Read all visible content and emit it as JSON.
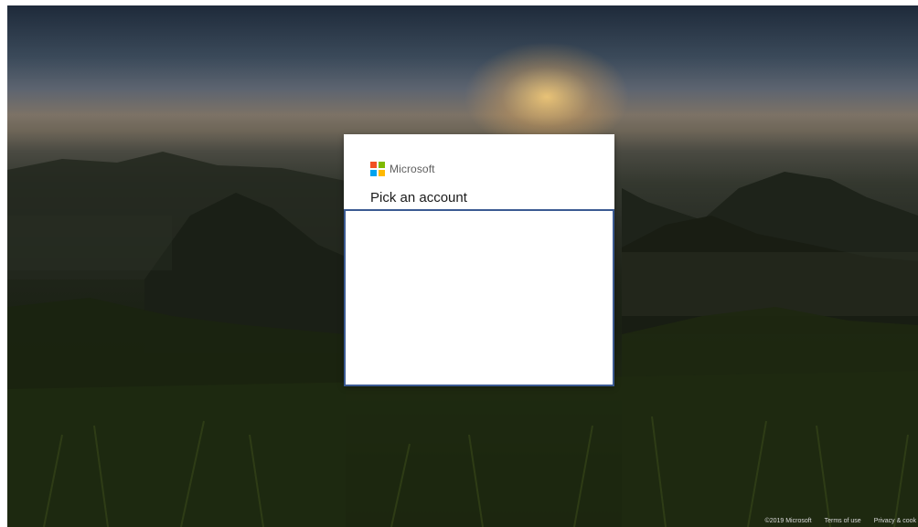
{
  "background": {
    "description_colors": {
      "sky_top": "#1e2a3a",
      "sun_glow": "#ffd278",
      "grass": "#1d2612"
    }
  },
  "dialog": {
    "brand": "Microsoft",
    "logo_colors": [
      "#f25022",
      "#7fba00",
      "#00a4ef",
      "#ffb900"
    ],
    "title": "Pick an account",
    "accent_color": "#3b5a92"
  },
  "footer": {
    "copyright": "©2019 Microsoft",
    "terms": "Terms of use",
    "privacy": "Privacy & cook"
  }
}
